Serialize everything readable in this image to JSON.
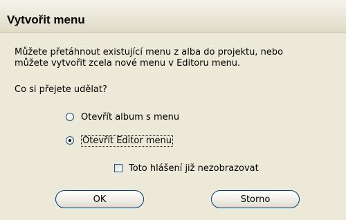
{
  "dialog": {
    "title": "Vytvořit menu",
    "intro_line1": "Můžete přetáhnout existující menu z alba do projektu, nebo",
    "intro_line2": "můžete vytvořit zcela nové menu v Editoru menu.",
    "question": "Co si přejete udělat?",
    "options": [
      {
        "label": "Otevřít album s menu",
        "checked": false
      },
      {
        "label": "Otevřít Editor menu",
        "checked": true
      }
    ],
    "dont_show_label": "Toto hlášení již nezobrazovat",
    "dont_show_checked": false,
    "ok_label": "OK",
    "cancel_label": "Storno"
  }
}
